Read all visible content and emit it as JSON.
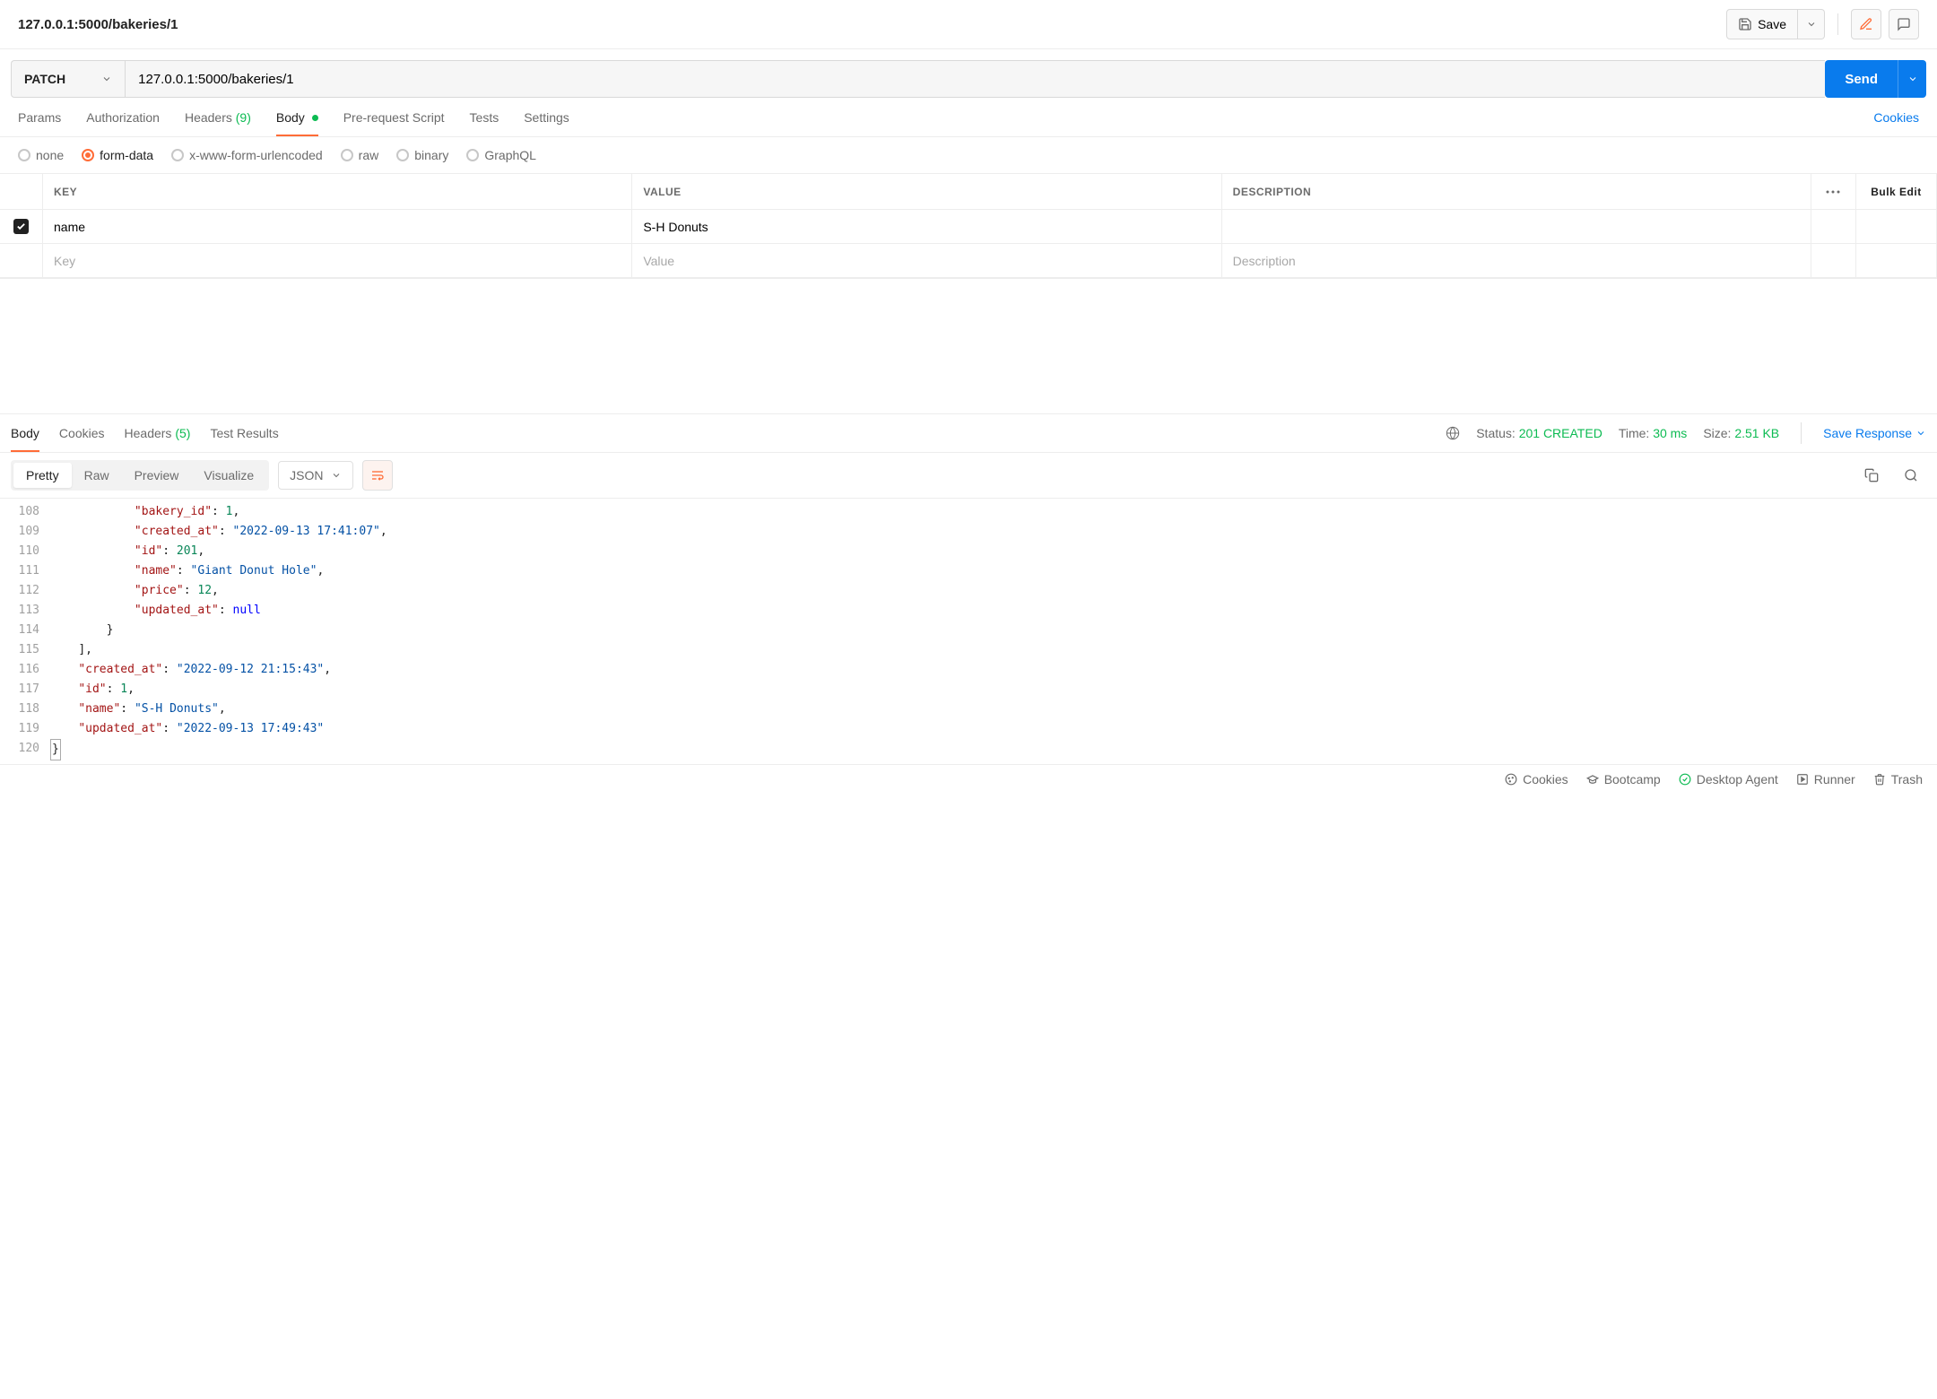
{
  "header": {
    "title": "127.0.0.1:5000/bakeries/1",
    "save_label": "Save"
  },
  "request": {
    "method": "PATCH",
    "url": "127.0.0.1:5000/bakeries/1",
    "send_label": "Send"
  },
  "req_tabs": {
    "params": "Params",
    "authorization": "Authorization",
    "headers": "Headers",
    "headers_count": "(9)",
    "body": "Body",
    "prerequest": "Pre-request Script",
    "tests": "Tests",
    "settings": "Settings",
    "cookies": "Cookies"
  },
  "body_radios": {
    "none": "none",
    "formdata": "form-data",
    "urlencoded": "x-www-form-urlencoded",
    "raw": "raw",
    "binary": "binary",
    "graphql": "GraphQL"
  },
  "kv": {
    "head_key": "KEY",
    "head_value": "VALUE",
    "head_desc": "DESCRIPTION",
    "bulk": "Bulk Edit",
    "rows": [
      {
        "checked": true,
        "key": "name",
        "value": "S-H Donuts",
        "desc": ""
      }
    ],
    "ph_key": "Key",
    "ph_value": "Value",
    "ph_desc": "Description"
  },
  "resp_tabs": {
    "body": "Body",
    "cookies": "Cookies",
    "headers": "Headers",
    "headers_count": "(5)",
    "test_results": "Test Results"
  },
  "resp_meta": {
    "status_label": "Status:",
    "status_value": "201 CREATED",
    "time_label": "Time:",
    "time_value": "30 ms",
    "size_label": "Size:",
    "size_value": "2.51 KB",
    "save_response": "Save Response"
  },
  "view": {
    "pretty": "Pretty",
    "raw": "Raw",
    "preview": "Preview",
    "visualize": "Visualize",
    "format": "JSON"
  },
  "code_lines": [
    {
      "n": 108,
      "indent": 3,
      "tokens": [
        [
          "k",
          "\"bakery_id\""
        ],
        [
          "p",
          ": "
        ],
        [
          "n",
          "1"
        ],
        [
          "p",
          ","
        ]
      ]
    },
    {
      "n": 109,
      "indent": 3,
      "tokens": [
        [
          "k",
          "\"created_at\""
        ],
        [
          "p",
          ": "
        ],
        [
          "s",
          "\"2022-09-13 17:41:07\""
        ],
        [
          "p",
          ","
        ]
      ]
    },
    {
      "n": 110,
      "indent": 3,
      "tokens": [
        [
          "k",
          "\"id\""
        ],
        [
          "p",
          ": "
        ],
        [
          "n",
          "201"
        ],
        [
          "p",
          ","
        ]
      ]
    },
    {
      "n": 111,
      "indent": 3,
      "tokens": [
        [
          "k",
          "\"name\""
        ],
        [
          "p",
          ": "
        ],
        [
          "s",
          "\"Giant Donut Hole\""
        ],
        [
          "p",
          ","
        ]
      ]
    },
    {
      "n": 112,
      "indent": 3,
      "tokens": [
        [
          "k",
          "\"price\""
        ],
        [
          "p",
          ": "
        ],
        [
          "n",
          "12"
        ],
        [
          "p",
          ","
        ]
      ]
    },
    {
      "n": 113,
      "indent": 3,
      "tokens": [
        [
          "k",
          "\"updated_at\""
        ],
        [
          "p",
          ": "
        ],
        [
          "null",
          "null"
        ]
      ]
    },
    {
      "n": 114,
      "indent": 2,
      "tokens": [
        [
          "p",
          "}"
        ]
      ]
    },
    {
      "n": 115,
      "indent": 1,
      "tokens": [
        [
          "p",
          "],"
        ]
      ]
    },
    {
      "n": 116,
      "indent": 1,
      "tokens": [
        [
          "k",
          "\"created_at\""
        ],
        [
          "p",
          ": "
        ],
        [
          "s",
          "\"2022-09-12 21:15:43\""
        ],
        [
          "p",
          ","
        ]
      ]
    },
    {
      "n": 117,
      "indent": 1,
      "tokens": [
        [
          "k",
          "\"id\""
        ],
        [
          "p",
          ": "
        ],
        [
          "n",
          "1"
        ],
        [
          "p",
          ","
        ]
      ]
    },
    {
      "n": 118,
      "indent": 1,
      "tokens": [
        [
          "k",
          "\"name\""
        ],
        [
          "p",
          ": "
        ],
        [
          "s",
          "\"S-H Donuts\""
        ],
        [
          "p",
          ","
        ]
      ]
    },
    {
      "n": 119,
      "indent": 1,
      "tokens": [
        [
          "k",
          "\"updated_at\""
        ],
        [
          "p",
          ": "
        ],
        [
          "s",
          "\"2022-09-13 17:49:43\""
        ]
      ]
    },
    {
      "n": 120,
      "indent": 0,
      "tokens": [
        [
          "caret",
          "}"
        ]
      ]
    }
  ],
  "footer": {
    "cookies": "Cookies",
    "bootcamp": "Bootcamp",
    "desktop_agent": "Desktop Agent",
    "runner": "Runner",
    "trash": "Trash"
  }
}
